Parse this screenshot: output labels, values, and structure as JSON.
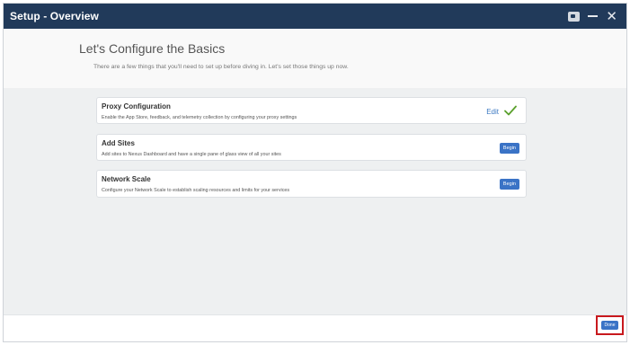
{
  "window": {
    "title": "Setup - Overview",
    "controls": {
      "video_icon": "video-icon",
      "minimize_icon": "minimize-icon",
      "close_icon": "close-icon",
      "close_glyph": "✕"
    }
  },
  "header": {
    "title": "Let's Configure the Basics",
    "subtitle": "There are a few things that you'll need to set up before diving in. Let's set those things up now."
  },
  "cards": [
    {
      "title": "Proxy Configuration",
      "description": "Enable the App Store, feedback, and telemetry collection by configuring your proxy settings",
      "action_label": "Edit",
      "status": "completed",
      "status_icon": "check-icon"
    },
    {
      "title": "Add Sites",
      "description": "Add sites to Nexus Dashboard and have a single pane of glass view of all your sites",
      "action_label": "Begin"
    },
    {
      "title": "Network Scale",
      "description": "Configure your Network Scale to establish scaling resources and limits for your services",
      "action_label": "Begin"
    }
  ],
  "footer": {
    "done_label": "Done"
  },
  "colors": {
    "titlebar": "#213a5a",
    "primary_button": "#3a73c6",
    "link": "#3b78c2",
    "check": "#5aa02c",
    "highlight": "#c8191e"
  }
}
